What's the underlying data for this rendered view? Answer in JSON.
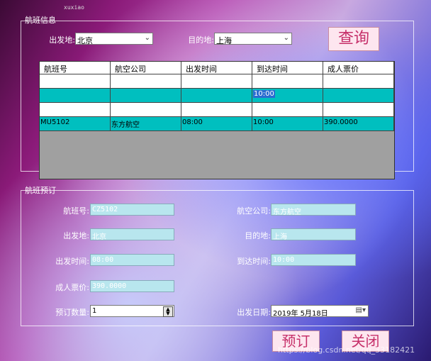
{
  "caption": "xuxiao",
  "flight_info": {
    "title": "航班信息",
    "departure_label": "出发地:",
    "departure_value": "北京",
    "destination_label": "目的地:",
    "destination_value": "上海",
    "query_button": "查询"
  },
  "grid": {
    "columns": [
      "航班号",
      "航空公司",
      "出发时间",
      "到达时间",
      "成人票价"
    ],
    "rows": [
      {
        "style": "white",
        "cells": [
          "",
          "",
          "",
          "",
          ""
        ]
      },
      {
        "style": "teal",
        "cells": [
          "",
          "",
          "",
          "10:00",
          ""
        ],
        "selected_col": 3
      },
      {
        "style": "white",
        "cells": [
          "",
          "",
          "",
          "",
          ""
        ]
      },
      {
        "style": "teal",
        "cells": [
          "MU5102",
          "东方航空",
          "08:00",
          "10:00",
          "390.0000"
        ]
      }
    ]
  },
  "booking": {
    "title": "航班预订",
    "flight_no_label": "航班号:",
    "flight_no_value": "CZ5102",
    "airline_label": "航空公司:",
    "airline_value": "东方航空",
    "departure_label": "出发地:",
    "departure_value": "北京",
    "destination_label": "目的地:",
    "destination_value": "上海",
    "dep_time_label": "出发时间:",
    "dep_time_value": "08:00",
    "arr_time_label": "到达时间:",
    "arr_time_value": "10:00",
    "price_label": "成人票价:",
    "price_value": "390.0000",
    "quantity_label": "预订数量:",
    "quantity_value": "1",
    "date_label": "出发日期:",
    "date_value": "2019年 5月18日"
  },
  "buttons": {
    "book": "预订",
    "close": "关闭"
  },
  "watermark": "https://blog.csdn.net/qq_33182421"
}
